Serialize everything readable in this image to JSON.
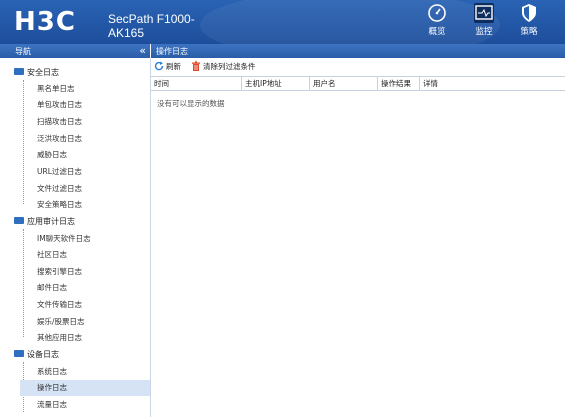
{
  "brand": {
    "logo": "H3C",
    "device_line1": "SecPath F1000-",
    "device_line2": "AK165"
  },
  "topnav": [
    {
      "label": "概览",
      "icon": "dashboard-icon"
    },
    {
      "label": "监控",
      "icon": "monitor-icon",
      "active": true
    },
    {
      "label": "策略",
      "icon": "shield-icon"
    }
  ],
  "nav": {
    "title": "导航",
    "collapse": "«",
    "groups": [
      {
        "label": "安全日志",
        "items": [
          "黑名单日志",
          "单包攻击日志",
          "扫描攻击日志",
          "泛洪攻击日志",
          "威胁日志",
          "URL过滤日志",
          "文件过滤日志",
          "安全策略日志"
        ]
      },
      {
        "label": "应用审计日志",
        "items": [
          "IM聊天软件日志",
          "社区日志",
          "搜索引擎日志",
          "邮件日志",
          "文件传输日志",
          "娱乐/股票日志",
          "其他应用日志"
        ]
      },
      {
        "label": "设备日志",
        "items": [
          "系统日志",
          "操作日志",
          "流量日志"
        ]
      }
    ],
    "active_item": "操作日志"
  },
  "main": {
    "title": "操作日志",
    "toolbar": {
      "refresh": "刷新",
      "clear_filter": "清除列过滤条件"
    },
    "columns": [
      "时间",
      "主机IP地址",
      "用户名",
      "操作结果",
      "详情"
    ],
    "empty_text": "没有可以显示的数据"
  }
}
